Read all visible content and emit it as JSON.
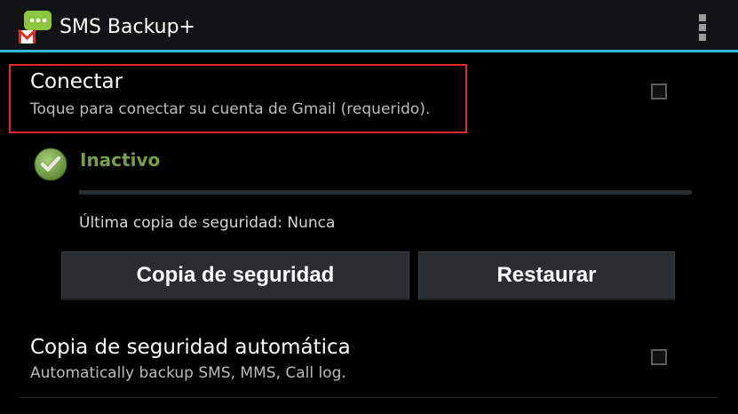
{
  "app": {
    "title": "SMS Backup+",
    "icon": "sms-backup-gmail-icon",
    "accent_color": "#33b5e5"
  },
  "action_bar": {
    "overflow_icon": "overflow-menu-icon"
  },
  "preferences": {
    "connect": {
      "title": "Conectar",
      "summary": "Toque para conectar su cuenta de Gmail (requerido).",
      "checked": false
    },
    "auto_backup": {
      "title": "Copia de seguridad automática",
      "summary": "Automatically backup SMS, MMS, Call log.",
      "checked": false
    }
  },
  "status": {
    "label": "Inactivo",
    "icon": "check-circle-icon",
    "color": "#779f4a",
    "progress": 0,
    "last_backup": "Última copia de seguridad: Nunca"
  },
  "buttons": {
    "backup_label": "Copia de seguridad",
    "restore_label": "Restaurar"
  },
  "highlight_color": "#e02b2b"
}
